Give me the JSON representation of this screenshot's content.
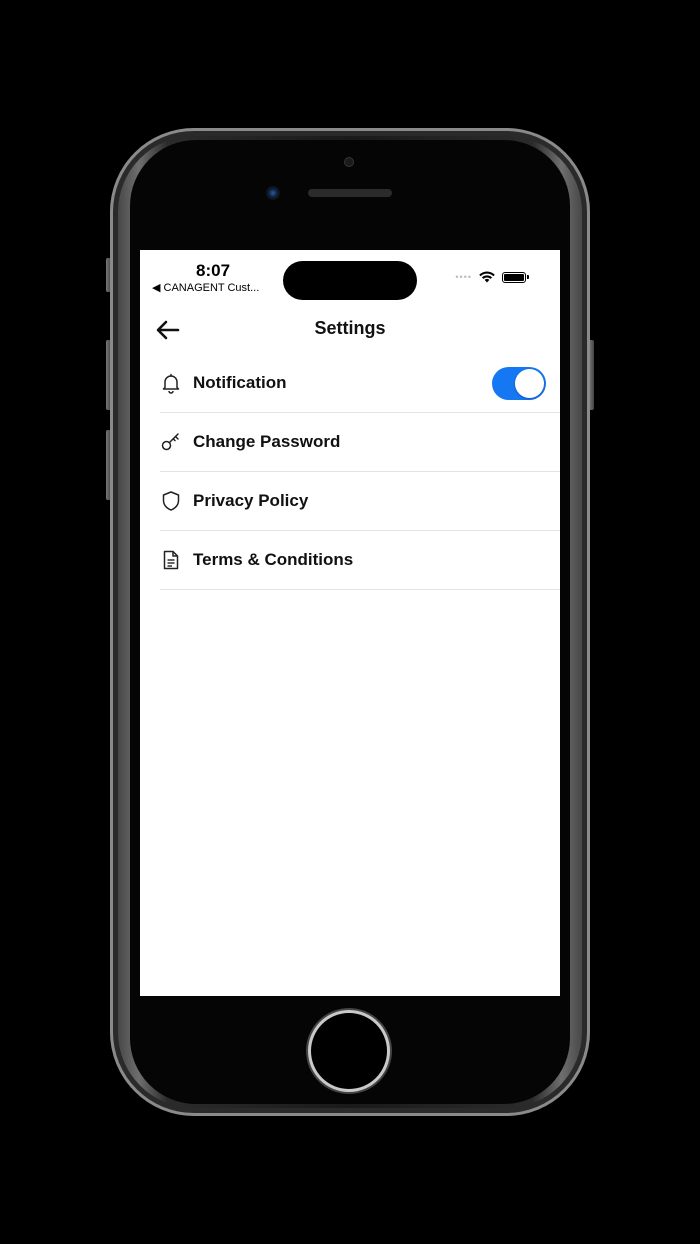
{
  "status_bar": {
    "time": "8:07",
    "back_app": "◀ CANAGENT Cust...",
    "signal": "••••"
  },
  "nav": {
    "title": "Settings",
    "back_icon": "arrow-left-icon"
  },
  "settings": [
    {
      "label": "Notification",
      "icon": "bell-icon",
      "toggle": true
    },
    {
      "label": "Change Password",
      "icon": "key-icon"
    },
    {
      "label": "Privacy Policy",
      "icon": "shield-icon"
    },
    {
      "label": "Terms & Conditions",
      "icon": "document-icon"
    }
  ],
  "colors": {
    "accent": "#1677f2",
    "background": "#ffffff",
    "text": "#111111",
    "divider": "#e3e3e3"
  }
}
